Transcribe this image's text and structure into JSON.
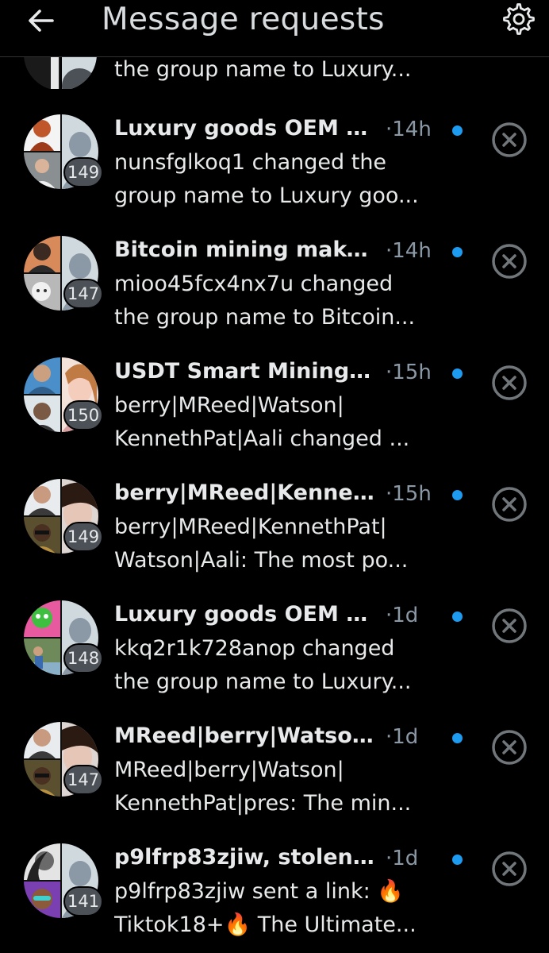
{
  "header": {
    "title": "Message requests",
    "back_icon": "arrow-left-icon",
    "settings_icon": "gear-icon"
  },
  "partial_item": {
    "preview_line": "the group name to Luxury..."
  },
  "colors": {
    "unread_dot": "#1d9bf0",
    "badge_bg": "#4b5157",
    "muted_text": "#8b98a5",
    "background": "#000000"
  },
  "requests": [
    {
      "name": "Luxury goods OEM fa...",
      "time": "·14h",
      "badge": "149",
      "preview1": "nunsfglkoq1 changed the",
      "preview2": "group name to Luxury goo..."
    },
    {
      "name": "Bitcoin mining make...",
      "time": "·14h",
      "badge": "147",
      "preview1": "mioo45fcx4nx7u changed",
      "preview2": "the group name to Bitcoin..."
    },
    {
      "name": "USDT Smart Mining ...",
      "time": "·15h",
      "badge": "150",
      "preview1": "berry|MReed|Watson|",
      "preview2": "KennethPat|Aali changed ..."
    },
    {
      "name": "berry|MReed|Kennet...",
      "time": "·15h",
      "badge": "149",
      "preview1": "berry|MReed|KennethPat|",
      "preview2": "Watson|Aali: The most po..."
    },
    {
      "name": "Luxury goods OEM fac...",
      "time": "·1d",
      "badge": "148",
      "preview1": "kkq2r1k728anop changed",
      "preview2": "the group name to Luxury..."
    },
    {
      "name": "MReed|berry|Watson|...",
      "time": "·1d",
      "badge": "147",
      "preview1": "MReed|berry|Watson|",
      "preview2": "KennethPat|pres: The min..."
    },
    {
      "name": "p9lfrp83zjiw, stolenm...",
      "time": "·1d",
      "badge": "141",
      "preview1": "p9lfrp83zjiw sent a link: 🔥",
      "preview2": "Tiktok18+🔥 The Ultimate..."
    }
  ]
}
